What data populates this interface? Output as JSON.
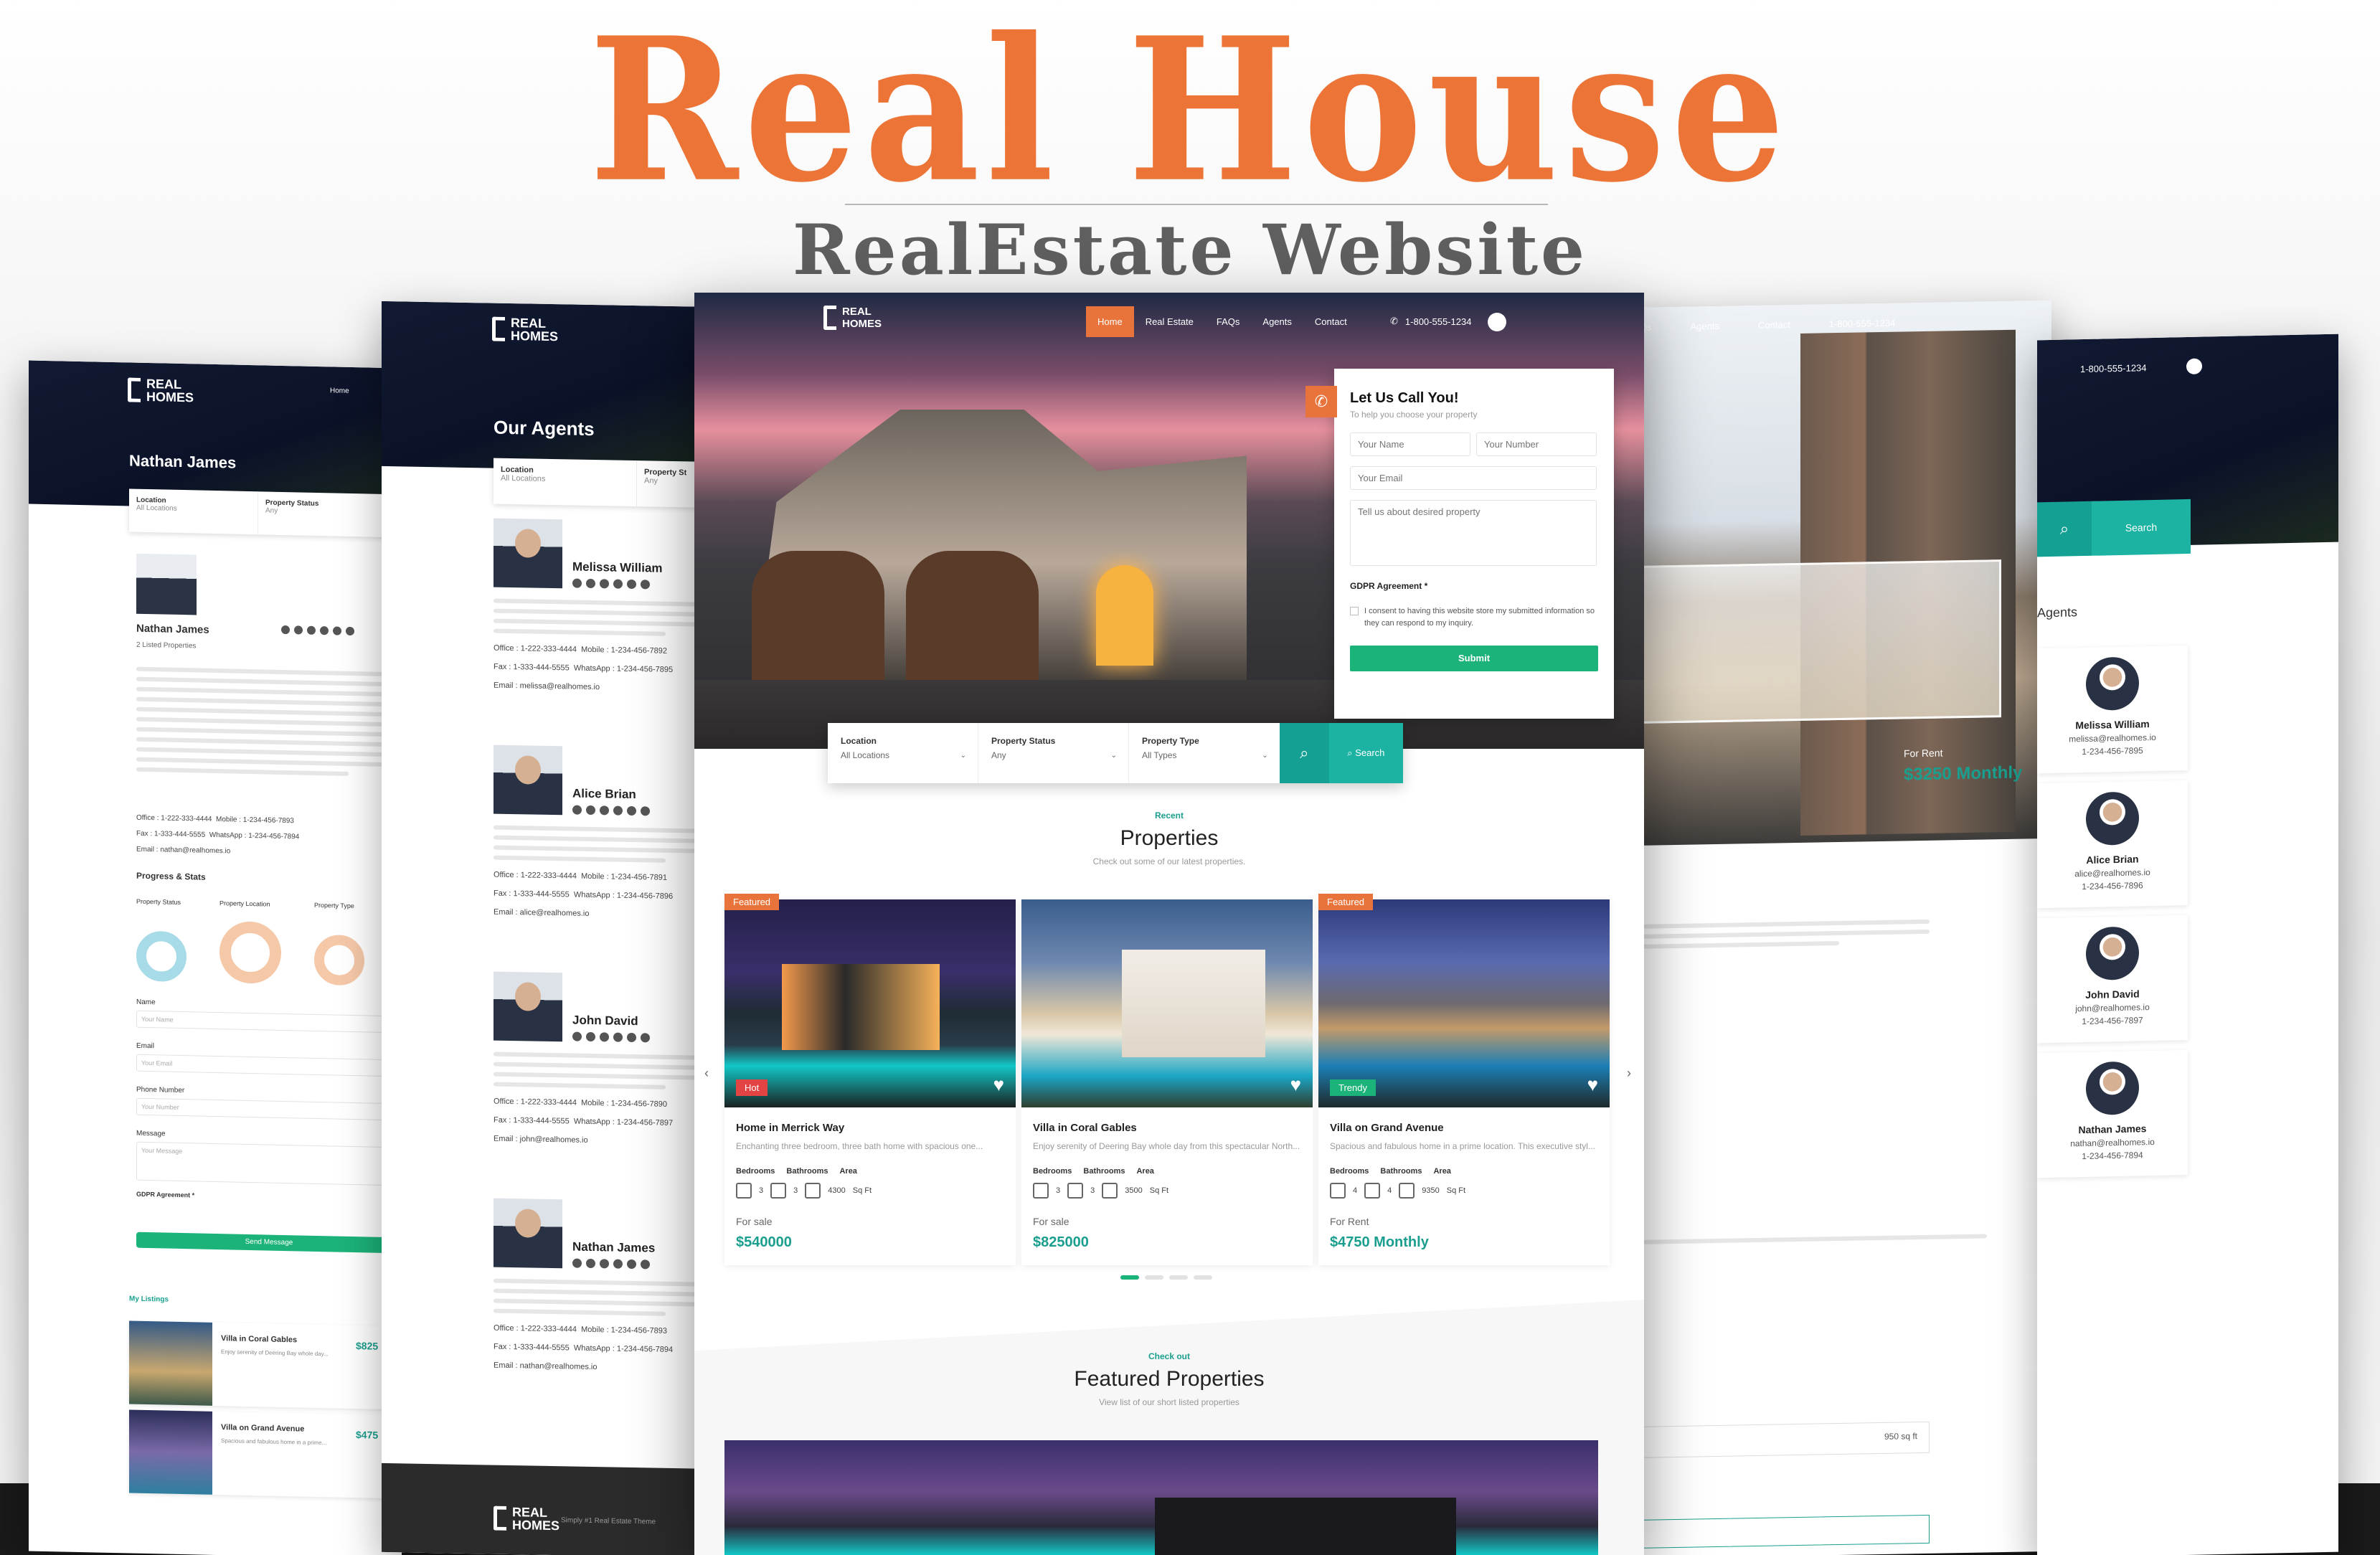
{
  "brand": {
    "title": "Real House",
    "subtitle": "RealEstate Website",
    "accent": "#ec7436"
  },
  "logo": {
    "line1": "REAL",
    "line2": "HOMES"
  },
  "nav": {
    "items": [
      "Home",
      "Real Estate",
      "FAQs",
      "Agents",
      "Contact"
    ],
    "phone": "1-800-555-1234",
    "active_color": "#e8743b"
  },
  "callback_form": {
    "title": "Let Us Call You!",
    "subtitle": "To help you choose your property",
    "name_placeholder": "Your Name",
    "number_placeholder": "Your Number",
    "email_placeholder": "Your Email",
    "message_placeholder": "Tell us about desired property",
    "gdpr_label": "GDPR Agreement *",
    "gdpr_text": "I consent to having this website store my submitted information so they can respond to my inquiry.",
    "submit_label": "Submit"
  },
  "search": {
    "location_label": "Location",
    "location_value": "All Locations",
    "status_label": "Property Status",
    "status_value": "Any",
    "type_label": "Property Type",
    "type_value": "All Types",
    "search_label": "Search"
  },
  "properties_section": {
    "eyebrow": "Recent",
    "title": "Properties",
    "subtitle": "Check out some of our latest properties."
  },
  "featured_section": {
    "eyebrow": "Check out",
    "title": "Featured Properties",
    "subtitle": "View list of our short listed properties"
  },
  "property_meta_labels": {
    "bedrooms": "Bedrooms",
    "bathrooms": "Bathrooms",
    "area": "Area",
    "sqft": "Sq Ft"
  },
  "properties": [
    {
      "badge": "Featured",
      "label": "Hot",
      "title": "Home in Merrick Way",
      "desc": "Enchanting three bedroom, three bath home with spacious one...",
      "beds": "3",
      "baths": "3",
      "area": "4300",
      "status": "For sale",
      "price": "$540000"
    },
    {
      "badge": "",
      "label": "",
      "title": "Villa in Coral Gables",
      "desc": "Enjoy serenity of Deering Bay whole day from this spectacular North...",
      "beds": "3",
      "baths": "3",
      "area": "3500",
      "status": "For sale",
      "price": "$825000"
    },
    {
      "badge": "Featured",
      "label": "Trendy",
      "title": "Villa on Grand Avenue",
      "desc": "Spacious and fabulous home in a prime location. This executive styl...",
      "beds": "4",
      "baths": "4",
      "area": "9350",
      "status": "For Rent",
      "price": "$4750 Monthly"
    }
  ],
  "left_panel": {
    "page_title": "Nathan James",
    "agent_name": "Nathan James",
    "listed": "2 Listed Properties",
    "office": "Office : 1-222-333-4444",
    "mobile": "Mobile : 1-234-456-7893",
    "fax": "Fax : 1-333-444-5555",
    "whatsapp": "WhatsApp : 1-234-456-7894",
    "email": "Email : nathan@realhomes.io",
    "stats_title": "Progress & Stats",
    "stat_labels": [
      "Property Status",
      "Property Location",
      "Property Type"
    ],
    "form_labels": [
      "Name",
      "Email",
      "Phone Number",
      "Message"
    ],
    "form_placeholders": [
      "Your Name",
      "Your Email",
      "Your Number",
      "Your Message"
    ],
    "gdpr": "GDPR Agreement *",
    "send_label": "Send Message",
    "listings_title": "My Listings",
    "listings": [
      {
        "title": "Villa in Coral Gables",
        "price": "$825",
        "desc": "Enjoy serenity of Deering Bay whole day..."
      },
      {
        "title": "Villa on Grand Avenue",
        "price": "$475",
        "desc": "Spacious and fabulous home in a prime..."
      }
    ],
    "nav_home": "Home",
    "location_label": "Location",
    "location_value": "All Locations",
    "status_label": "Property Status",
    "status_value": "Any"
  },
  "agents_panel": {
    "title": "Our Agents",
    "location_label": "Location",
    "location_value": "All Locations",
    "status_label": "Property St",
    "status_value": "Any",
    "agents": [
      {
        "name": "Melissa William",
        "office": "Office : 1-222-333-4444",
        "mobile": "Mobile : 1-234-456-7892",
        "fax": "Fax : 1-333-444-5555",
        "whatsapp": "WhatsApp : 1-234-456-7895",
        "email": "Email : melissa@realhomes.io"
      },
      {
        "name": "Alice Brian",
        "office": "Office : 1-222-333-4444",
        "mobile": "Mobile : 1-234-456-7891",
        "fax": "Fax : 1-333-444-5555",
        "whatsapp": "WhatsApp : 1-234-456-7896",
        "email": "Email : alice@realhomes.io"
      },
      {
        "name": "John David",
        "office": "Office : 1-222-333-4444",
        "mobile": "Mobile : 1-234-456-7890",
        "fax": "Fax : 1-333-444-5555",
        "whatsapp": "WhatsApp : 1-234-456-7897",
        "email": "Email : john@realhomes.io"
      },
      {
        "name": "Nathan James",
        "office": "Office : 1-222-333-4444",
        "mobile": "Mobile : 1-234-456-7893",
        "fax": "Fax : 1-333-444-5555",
        "whatsapp": "WhatsApp : 1-234-456-7894",
        "email": "Email : nathan@realhomes.io"
      }
    ],
    "footer_text": "Simply #1 Real Estate Theme"
  },
  "right_panel": {
    "nav": [
      "FAQs",
      "Agents",
      "Contact"
    ],
    "phone": "1-800-555-1234",
    "for_rent": "For Rent",
    "price": "$3250 Monthly",
    "area_value": "950 sq ft"
  },
  "far_right_panel": {
    "phone": "1-800-555-1234",
    "search_label": "Search",
    "agents_title": "Agents",
    "agents": [
      {
        "name": "Melissa William",
        "email": "melissa@realhomes.io",
        "phone": "1-234-456-7895"
      },
      {
        "name": "Alice Brian",
        "email": "alice@realhomes.io",
        "phone": "1-234-456-7896"
      },
      {
        "name": "John David",
        "email": "john@realhomes.io",
        "phone": "1-234-456-7897"
      },
      {
        "name": "Nathan James",
        "email": "nathan@realhomes.io",
        "phone": "1-234-456-7894"
      }
    ]
  }
}
